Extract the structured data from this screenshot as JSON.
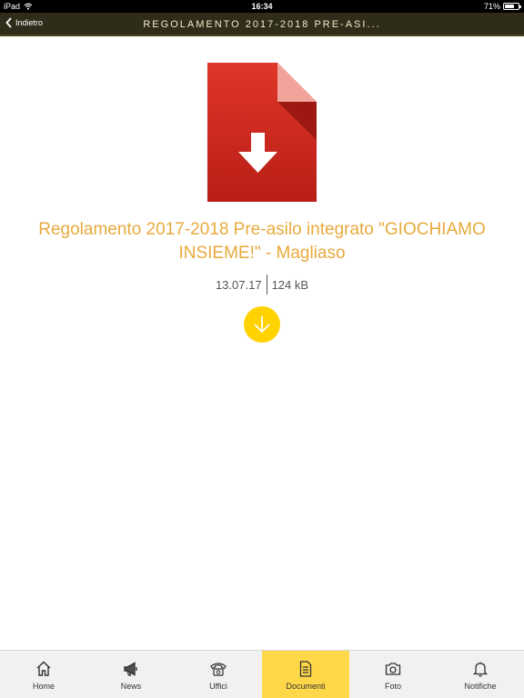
{
  "status_bar": {
    "carrier": "iPad",
    "time": "16:34",
    "battery": "71%",
    "battery_level": 0.71
  },
  "nav": {
    "back_label": "Indietro",
    "title": "REGOLAMENTO 2017-2018 PRE-ASI..."
  },
  "document": {
    "title": "Regolamento 2017-2018 Pre-asilo integrato \"GIOCHIAMO INSIEME!\" - Magliaso",
    "date": "13.07.17",
    "size": "124 kB",
    "icon": "pdf-download-icon"
  },
  "colors": {
    "accent": "#ffd200",
    "title": "#e8aa3c",
    "navbar": "#2f2c1a",
    "doc_red": "#d42b22",
    "active_tab": "#ffd84a"
  },
  "tabs": [
    {
      "label": "Home",
      "icon": "home-icon",
      "active": false
    },
    {
      "label": "News",
      "icon": "megaphone-icon",
      "active": false
    },
    {
      "label": "Uffici",
      "icon": "phone-icon",
      "active": false
    },
    {
      "label": "Documenti",
      "icon": "document-icon",
      "active": true
    },
    {
      "label": "Foto",
      "icon": "camera-icon",
      "active": false
    },
    {
      "label": "Notifiche",
      "icon": "bell-icon",
      "active": false
    }
  ]
}
